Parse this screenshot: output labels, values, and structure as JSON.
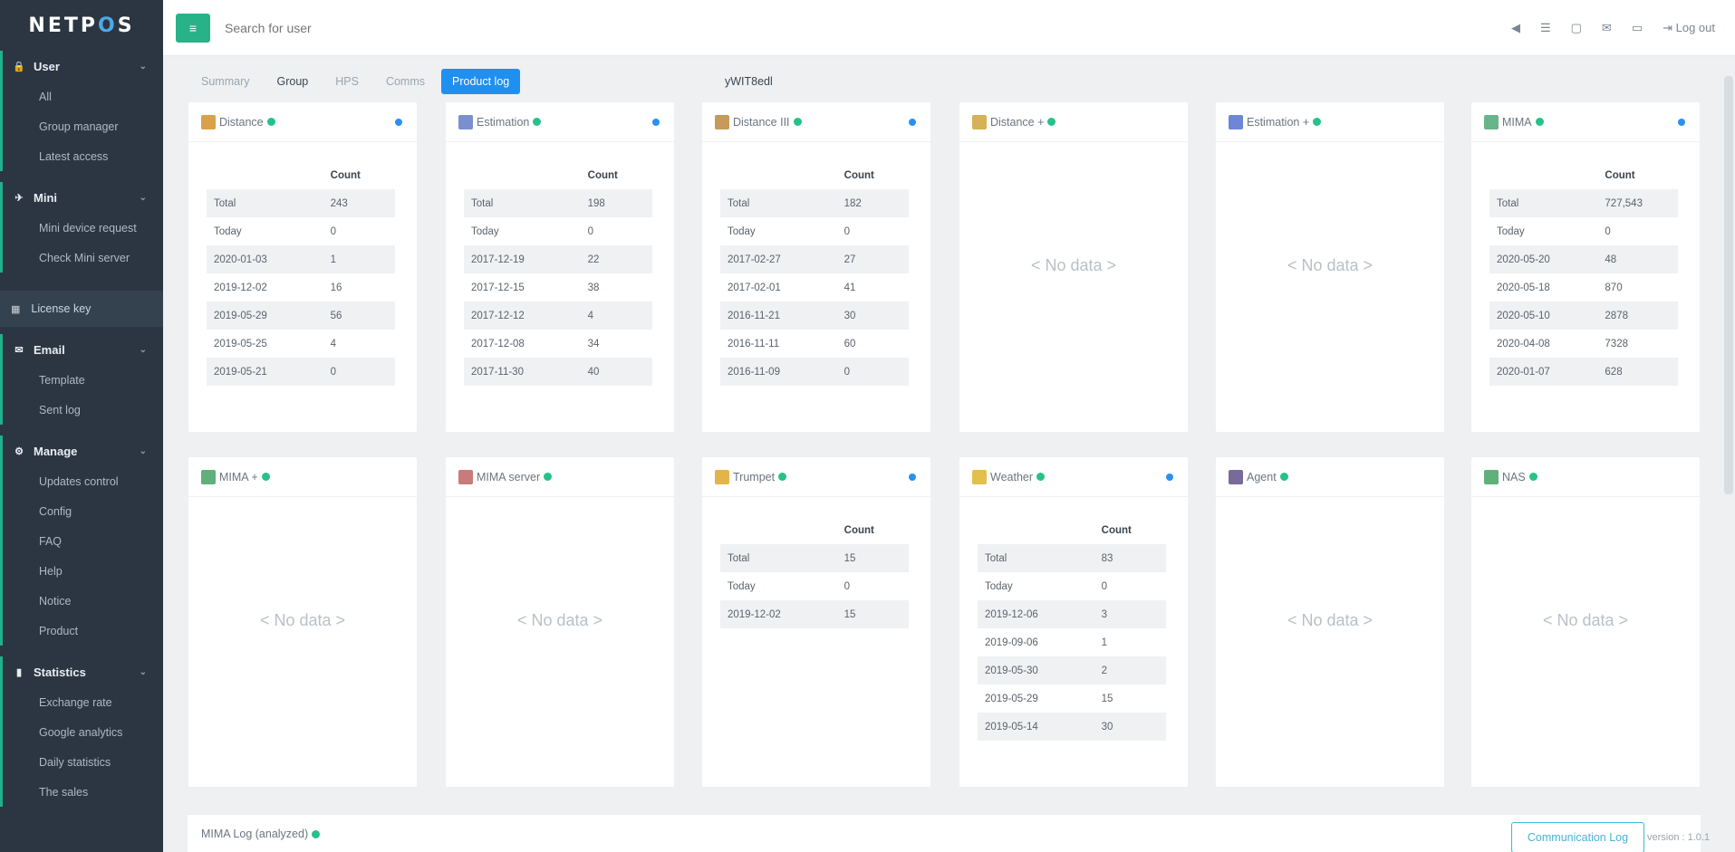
{
  "brand": {
    "logo_a": "NETP",
    "logo_b": "O",
    "logo_c": "S"
  },
  "sidebar": {
    "groups": [
      {
        "label": "User",
        "icon": "lock-icon",
        "items": [
          "All",
          "Group manager",
          "Latest access"
        ]
      },
      {
        "label": "Mini",
        "icon": "plane-icon",
        "items": [
          "Mini device request",
          "Check Mini server"
        ]
      }
    ],
    "single": {
      "label": "License key",
      "icon": "grid-icon"
    },
    "groups2": [
      {
        "label": "Email",
        "icon": "mail-icon",
        "items": [
          "Template",
          "Sent log"
        ]
      },
      {
        "label": "Manage",
        "icon": "gear-icon",
        "items": [
          "Updates control",
          "Config",
          "FAQ",
          "Help",
          "Notice",
          "Product"
        ]
      },
      {
        "label": "Statistics",
        "icon": "chart-icon",
        "items": [
          "Exchange rate",
          "Google analytics",
          "Daily statistics",
          "The sales"
        ]
      }
    ]
  },
  "topbar": {
    "search_placeholder": "Search for user",
    "logout": "Log out"
  },
  "tabs": [
    "Summary",
    "Group",
    "HPS",
    "Comms",
    "Product log"
  ],
  "filter_label": "yWIT8edl",
  "cards": [
    {
      "title": "Distance",
      "color": "#d9a14a",
      "header": "Count",
      "rows": [
        [
          "Total",
          "243"
        ],
        [
          "Today",
          "0"
        ],
        [
          "2020-01-03",
          "1"
        ],
        [
          "2019-12-02",
          "16"
        ],
        [
          "2019-05-29",
          "56"
        ],
        [
          "2019-05-25",
          "4"
        ],
        [
          "2019-05-21",
          "0"
        ]
      ]
    },
    {
      "title": "Estimation",
      "color": "#7a8fd0",
      "header": "Count",
      "rows": [
        [
          "Total",
          "198"
        ],
        [
          "Today",
          "0"
        ],
        [
          "2017-12-19",
          "22"
        ],
        [
          "2017-12-15",
          "38"
        ],
        [
          "2017-12-12",
          "4"
        ],
        [
          "2017-12-08",
          "34"
        ],
        [
          "2017-11-30",
          "40"
        ]
      ]
    },
    {
      "title": "Distance III",
      "color": "#c59a5a",
      "header": "Count",
      "rows": [
        [
          "Total",
          "182"
        ],
        [
          "Today",
          "0"
        ],
        [
          "2017-02-27",
          "27"
        ],
        [
          "2017-02-01",
          "41"
        ],
        [
          "2016-11-21",
          "30"
        ],
        [
          "2016-11-11",
          "60"
        ],
        [
          "2016-11-09",
          "0"
        ]
      ]
    },
    {
      "title": "Distance +",
      "color": "#d6b155",
      "header": "",
      "rows": [],
      "nodata": "< No data >"
    },
    {
      "title": "Estimation +",
      "color": "#6d86d6",
      "header": "",
      "rows": [],
      "nodata": "< No data >"
    },
    {
      "title": "MIMA",
      "color": "#68b58a",
      "header": "Count",
      "rows": [
        [
          "Total",
          "727,543"
        ],
        [
          "Today",
          "0"
        ],
        [
          "2020-05-20",
          "48"
        ],
        [
          "2020-05-18",
          "870"
        ],
        [
          "2020-05-10",
          "2878"
        ],
        [
          "2020-04-08",
          "7328"
        ],
        [
          "2020-01-07",
          "628"
        ]
      ]
    },
    {
      "title": "MIMA +",
      "color": "#5fb07a",
      "header": "",
      "rows": [],
      "nodata": "< No data >"
    },
    {
      "title": "MIMA server",
      "color": "#c97a7a",
      "header": "",
      "rows": [],
      "nodata": "< No data >"
    },
    {
      "title": "Trumpet",
      "color": "#e6b34a",
      "header": "Count",
      "rows": [
        [
          "Total",
          "15"
        ],
        [
          "Today",
          "0"
        ],
        [
          "2019-12-02",
          "15"
        ]
      ]
    },
    {
      "title": "Weather",
      "color": "#e2c04a",
      "header": "Count",
      "rows": [
        [
          "Total",
          "83"
        ],
        [
          "Today",
          "0"
        ],
        [
          "2019-12-06",
          "3"
        ],
        [
          "2019-09-06",
          "1"
        ],
        [
          "2019-05-30",
          "2"
        ],
        [
          "2019-05-29",
          "15"
        ],
        [
          "2019-05-14",
          "30"
        ]
      ]
    },
    {
      "title": "Agent",
      "color": "#7a6a9a",
      "header": "",
      "rows": [],
      "nodata": "< No data >"
    },
    {
      "title": "NAS",
      "color": "#5fb07a",
      "header": "",
      "rows": [],
      "nodata": "< No data >"
    }
  ],
  "bottom": {
    "title": "MIMA Log (analyzed)",
    "button": "Communication Log",
    "version": "version : 1.0.1"
  }
}
